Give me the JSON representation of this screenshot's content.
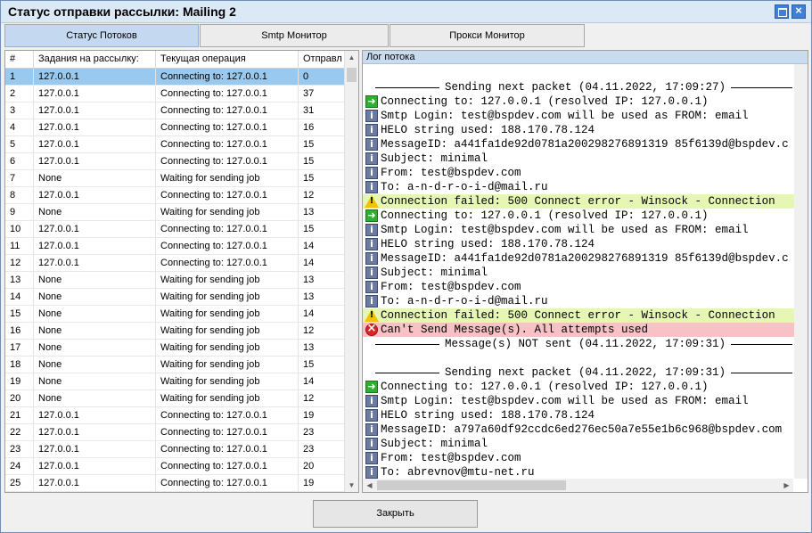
{
  "window": {
    "title": "Статус отправки рассылки: Mailing 2"
  },
  "tabs": [
    {
      "label": "Статус Потоков"
    },
    {
      "label": "Smtp Монитор"
    },
    {
      "label": "Прокси Монитор"
    }
  ],
  "threads": {
    "columns": [
      "#",
      "Задания на рассылку:",
      "Текущая операция",
      "Отправл"
    ],
    "rows": [
      [
        "1",
        "127.0.0.1",
        "Connecting to: 127.0.0.1",
        "0"
      ],
      [
        "2",
        "127.0.0.1",
        "Connecting to: 127.0.0.1",
        "37"
      ],
      [
        "3",
        "127.0.0.1",
        "Connecting to: 127.0.0.1",
        "31"
      ],
      [
        "4",
        "127.0.0.1",
        "Connecting to: 127.0.0.1",
        "16"
      ],
      [
        "5",
        "127.0.0.1",
        "Connecting to: 127.0.0.1",
        "15"
      ],
      [
        "6",
        "127.0.0.1",
        "Connecting to: 127.0.0.1",
        "15"
      ],
      [
        "7",
        "None",
        "Waiting for sending job",
        "15"
      ],
      [
        "8",
        "127.0.0.1",
        "Connecting to: 127.0.0.1",
        "12"
      ],
      [
        "9",
        "None",
        "Waiting for sending job",
        "13"
      ],
      [
        "10",
        "127.0.0.1",
        "Connecting to: 127.0.0.1",
        "15"
      ],
      [
        "11",
        "127.0.0.1",
        "Connecting to: 127.0.0.1",
        "14"
      ],
      [
        "12",
        "127.0.0.1",
        "Connecting to: 127.0.0.1",
        "14"
      ],
      [
        "13",
        "None",
        "Waiting for sending job",
        "13"
      ],
      [
        "14",
        "None",
        "Waiting for sending job",
        "13"
      ],
      [
        "15",
        "None",
        "Waiting for sending job",
        "14"
      ],
      [
        "16",
        "None",
        "Waiting for sending job",
        "12"
      ],
      [
        "17",
        "None",
        "Waiting for sending job",
        "13"
      ],
      [
        "18",
        "None",
        "Waiting for sending job",
        "15"
      ],
      [
        "19",
        "None",
        "Waiting for sending job",
        "14"
      ],
      [
        "20",
        "None",
        "Waiting for sending job",
        "12"
      ],
      [
        "21",
        "127.0.0.1",
        "Connecting to: 127.0.0.1",
        "19"
      ],
      [
        "22",
        "127.0.0.1",
        "Connecting to: 127.0.0.1",
        "23"
      ],
      [
        "23",
        "127.0.0.1",
        "Connecting to: 127.0.0.1",
        "23"
      ],
      [
        "24",
        "127.0.0.1",
        "Connecting to: 127.0.0.1",
        "20"
      ],
      [
        "25",
        "127.0.0.1",
        "Connecting to: 127.0.0.1",
        "19"
      ]
    ],
    "selected_row": 0
  },
  "log": {
    "title": "Лог потока",
    "lines": [
      {
        "kind": "sep",
        "text": "Sending next packet (04.11.2022, 17:09:27)"
      },
      {
        "kind": "arrow",
        "text": "Connecting to: 127.0.0.1 (resolved IP: 127.0.0.1)"
      },
      {
        "kind": "info",
        "text": "Smtp Login: test@bspdev.com will be used as FROM: email"
      },
      {
        "kind": "info",
        "text": "HELO string used: 188.170.78.124"
      },
      {
        "kind": "info",
        "text": "MessageID: a441fa1de92d0781a200298276891319 85f6139d@bspdev.c"
      },
      {
        "kind": "info",
        "text": "Subject: minimal"
      },
      {
        "kind": "info",
        "text": "From: test@bspdev.com"
      },
      {
        "kind": "info",
        "text": "To: a-n-d-r-o-i-d@mail.ru"
      },
      {
        "kind": "warn",
        "text": "Connection failed: 500 Connect error - Winsock - Connection"
      },
      {
        "kind": "arrow",
        "text": "Connecting to: 127.0.0.1 (resolved IP: 127.0.0.1)"
      },
      {
        "kind": "info",
        "text": "Smtp Login: test@bspdev.com will be used as FROM: email"
      },
      {
        "kind": "info",
        "text": "HELO string used: 188.170.78.124"
      },
      {
        "kind": "info",
        "text": "MessageID: a441fa1de92d0781a200298276891319 85f6139d@bspdev.c"
      },
      {
        "kind": "info",
        "text": "Subject: minimal"
      },
      {
        "kind": "info",
        "text": "From: test@bspdev.com"
      },
      {
        "kind": "info",
        "text": "To: a-n-d-r-o-i-d@mail.ru"
      },
      {
        "kind": "warn",
        "text": "Connection failed: 500 Connect error - Winsock - Connection"
      },
      {
        "kind": "err",
        "text": "Can't Send Message(s). All attempts used"
      },
      {
        "kind": "sep",
        "text": "Message(s) NOT sent (04.11.2022, 17:09:31)"
      },
      {
        "kind": "blank",
        "text": ""
      },
      {
        "kind": "sep",
        "text": "Sending next packet (04.11.2022, 17:09:31)"
      },
      {
        "kind": "arrow",
        "text": "Connecting to: 127.0.0.1 (resolved IP: 127.0.0.1)"
      },
      {
        "kind": "info",
        "text": "Smtp Login: test@bspdev.com will be used as FROM: email"
      },
      {
        "kind": "info",
        "text": "HELO string used: 188.170.78.124"
      },
      {
        "kind": "info",
        "text": "MessageID: a797a60df92ccdc6ed276ec50a7e55e1b6c968@bspdev.com"
      },
      {
        "kind": "info",
        "text": "Subject: minimal"
      },
      {
        "kind": "info",
        "text": "From: test@bspdev.com"
      },
      {
        "kind": "info",
        "text": "To: abrevnov@mtu-net.ru"
      }
    ]
  },
  "footer": {
    "close_label": "Закрыть"
  }
}
